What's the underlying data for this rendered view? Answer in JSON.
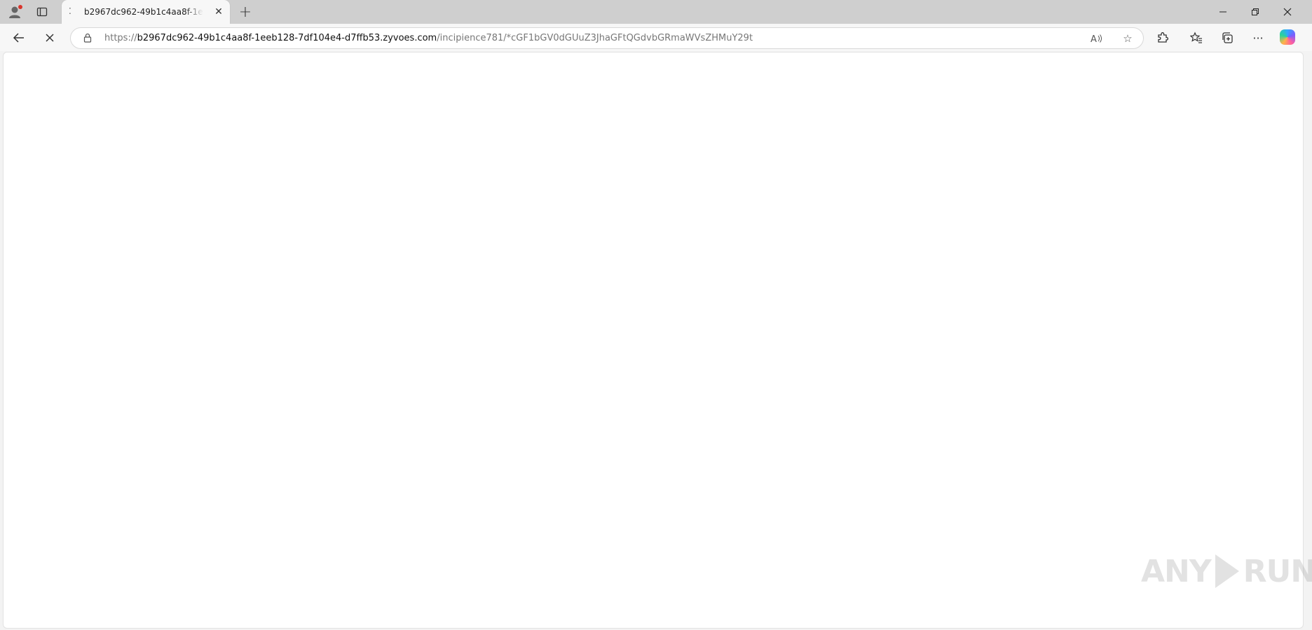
{
  "browser": {
    "tab": {
      "title": "b2967dc962-49b1c4aa8f-1eeb128-7df104e4-d7ffb53.zyvoes.com",
      "loading_indicator": "spinner"
    },
    "address_bar": {
      "scheme": "https://",
      "host": "b2967dc962-49b1c4aa8f-1eeb128-7df104e4-d7ffb53.zyvoes.com",
      "path": "/incipience781/*cGF1bGV0dGUuZ3JhaGFtQGdvbGRmaWVsZHMuY29t"
    },
    "icons": {
      "profile": "profile-icon",
      "tab_actions": "tab-actions-icon",
      "new_tab": "plus-icon",
      "minimize": "minimize-icon",
      "restore": "restore-icon",
      "close": "close-icon",
      "back": "back-arrow-icon",
      "stop": "stop-icon",
      "lock": "lock-icon",
      "read_aloud": "read-aloud-icon",
      "favorite": "star-icon",
      "extensions": "puzzle-icon",
      "favorites": "favorites-icon",
      "collections": "collections-icon",
      "more": "more-icon",
      "copilot": "copilot-icon"
    }
  },
  "page": {
    "content": ""
  },
  "watermark": {
    "left": "ANY",
    "right": "RUN"
  }
}
